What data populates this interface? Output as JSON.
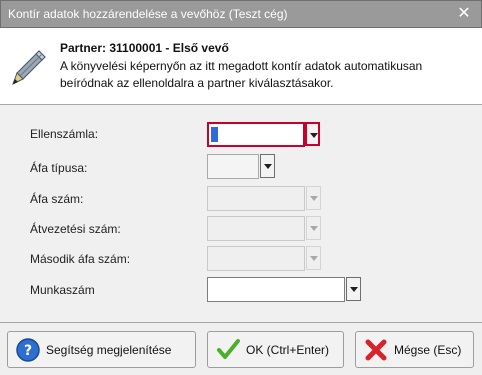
{
  "window": {
    "title": "Kontír adatok hozzárendelése a vevőhöz (Teszt cég)",
    "close_glyph": "✕"
  },
  "header": {
    "icon": "pen-icon",
    "title": "Partner: 31100001 - Első vevő",
    "line1": "A könyvelési képernyőn az itt megadott kontír adatok automatikusan",
    "line2": "beíródnak az ellenoldalra a partner kiválasztásakor."
  },
  "form": {
    "fields": [
      {
        "label": "Ellenszámla:",
        "value": "",
        "state": "focused"
      },
      {
        "label": "Áfa típusa:",
        "value": "",
        "state": "enabled"
      },
      {
        "label": "Áfa szám:",
        "value": "",
        "state": "disabled"
      },
      {
        "label": "Átvezetési szám:",
        "value": "",
        "state": "disabled"
      },
      {
        "label": "Második áfa szám:",
        "value": "",
        "state": "disabled"
      },
      {
        "label": "Munkaszám",
        "value": "",
        "state": "enabled"
      }
    ]
  },
  "buttons": {
    "help": {
      "label": "Segítség megjelenítése",
      "icon": "help-icon"
    },
    "ok": {
      "label": "OK (Ctrl+Enter)",
      "icon": "checkmark-icon"
    },
    "cancel": {
      "label": "Mégse (Esc)",
      "icon": "x-icon"
    }
  },
  "colors": {
    "titlebar": "#9a9a9a",
    "focus_border": "#c9002b",
    "ok_green": "#4caf2a",
    "cancel_red": "#d8232a",
    "help_blue": "#2c6fd0"
  }
}
